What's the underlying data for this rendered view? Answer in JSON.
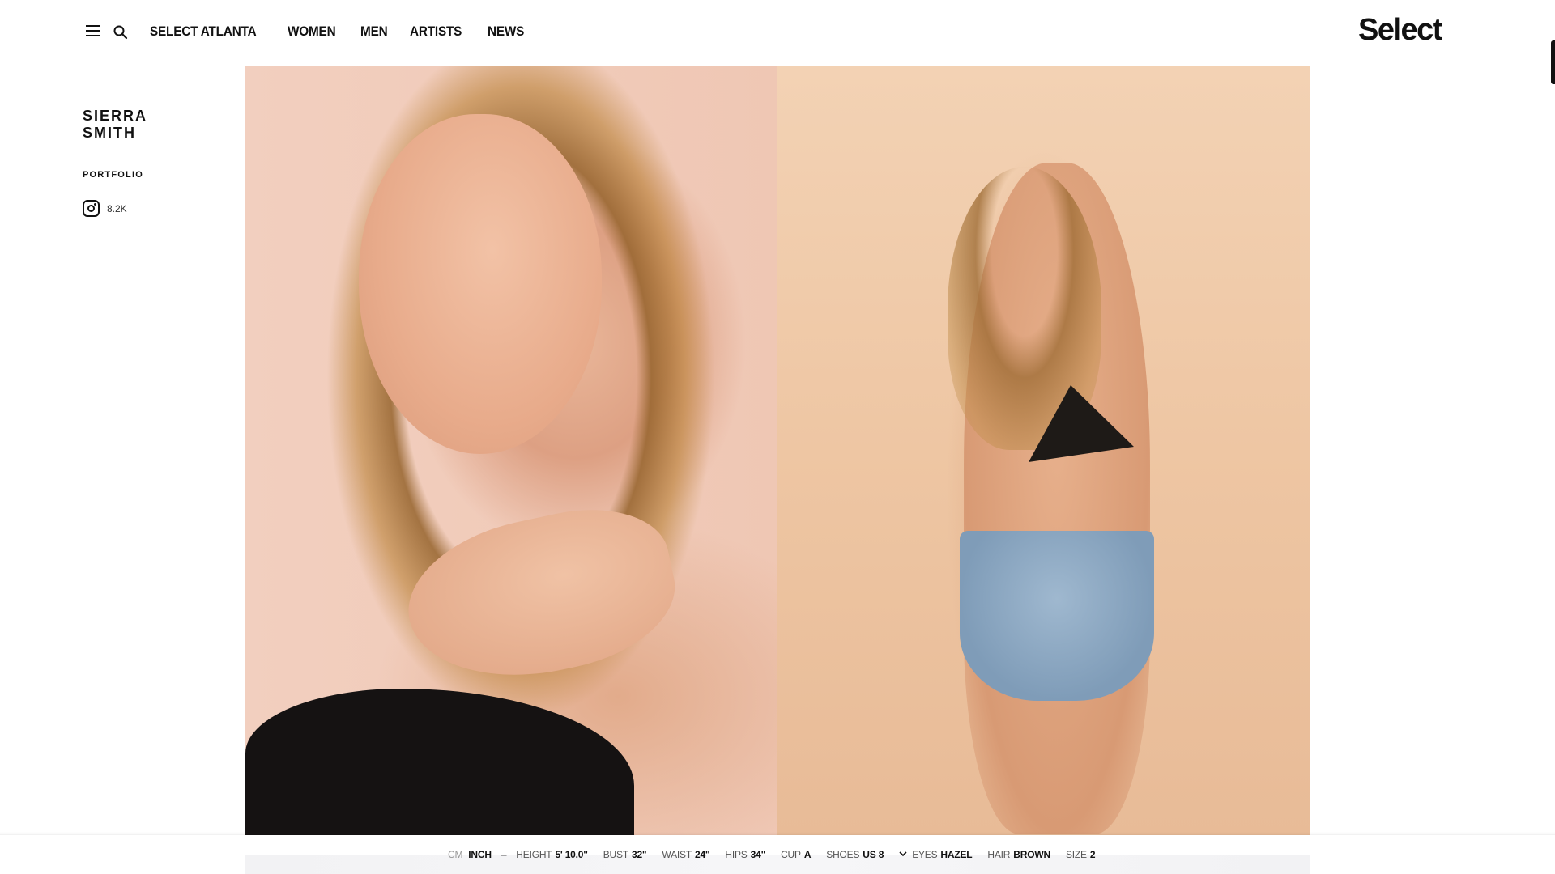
{
  "header": {
    "nav": [
      "SELECT ATLANTA",
      "WOMEN",
      "MEN",
      "ARTISTS",
      "NEWS"
    ],
    "logo": "Select",
    "icons": {
      "menu": "hamburger-icon",
      "search": "search-icon"
    }
  },
  "sidebar": {
    "name_first": "SIERRA",
    "name_last": "SMITH",
    "portfolio": "PORTFOLIO",
    "instagram_count": "8.2K",
    "instagram_icon": "instagram-icon"
  },
  "photos": [
    {
      "alt": "portrait-closeup"
    },
    {
      "alt": "full-length-pose"
    }
  ],
  "stats": {
    "unit_cm": "CM",
    "unit_inch": "INCH",
    "dash": "–",
    "items": [
      {
        "label": "HEIGHT",
        "value": "5' 10.0\""
      },
      {
        "label": "BUST",
        "value": "32\""
      },
      {
        "label": "WAIST",
        "value": "24\""
      },
      {
        "label": "HIPS",
        "value": "34\""
      },
      {
        "label": "CUP",
        "value": "A"
      },
      {
        "label": "SHOES",
        "value": "US 8"
      },
      {
        "label": "EYES",
        "value": "HAZEL"
      },
      {
        "label": "HAIR",
        "value": "BROWN"
      },
      {
        "label": "SIZE",
        "value": "2"
      }
    ]
  },
  "colors": {
    "text": "#111111",
    "background": "#ffffff"
  }
}
